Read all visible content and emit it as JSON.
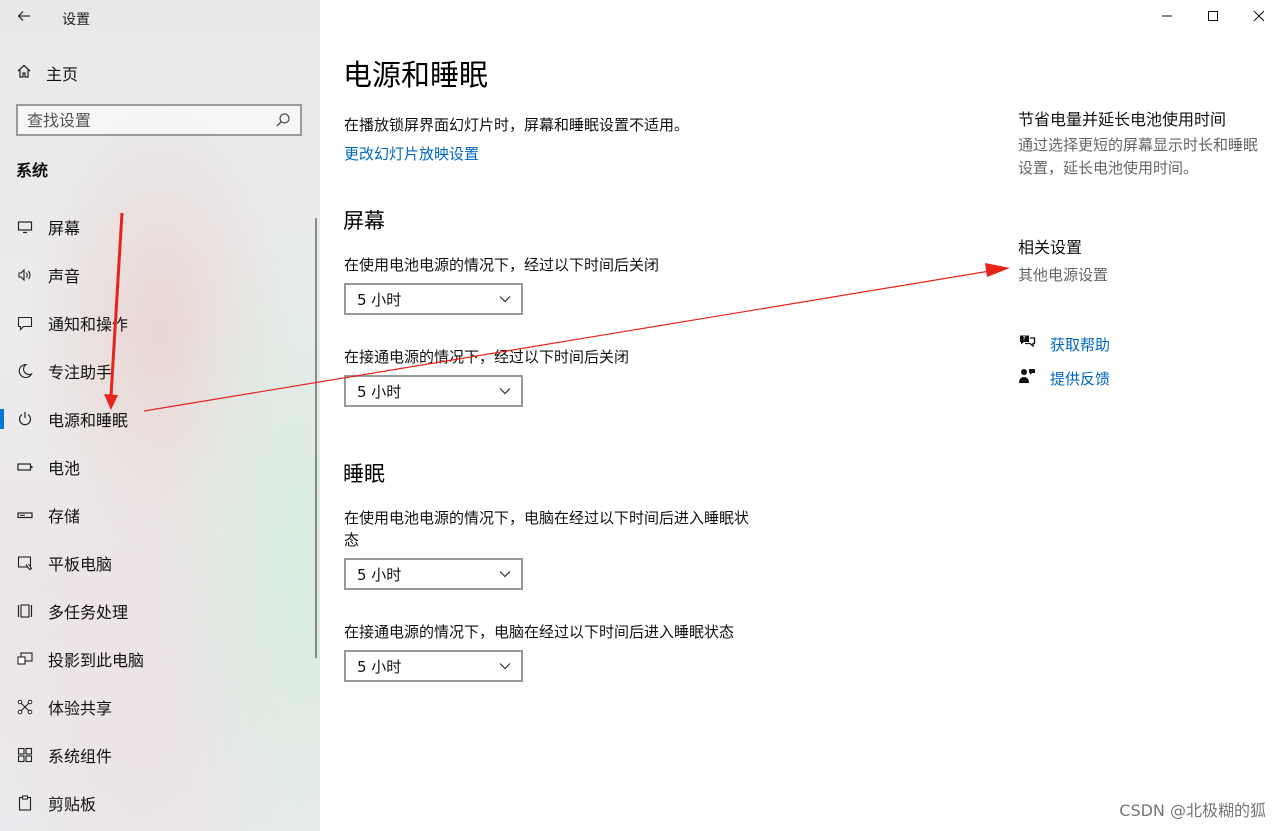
{
  "window": {
    "title": "设置",
    "minimize": "—",
    "maximize": "☐",
    "close": "✕"
  },
  "sidebar": {
    "home_label": "主页",
    "search_placeholder": "查找设置",
    "section_title": "系统",
    "items": [
      {
        "icon": "monitor-icon",
        "label": "屏幕"
      },
      {
        "icon": "speaker-icon",
        "label": "声音"
      },
      {
        "icon": "notification-icon",
        "label": "通知和操作"
      },
      {
        "icon": "moon-icon",
        "label": "专注助手"
      },
      {
        "icon": "power-icon",
        "label": "电源和睡眠",
        "active": true
      },
      {
        "icon": "battery-icon",
        "label": "电池"
      },
      {
        "icon": "storage-icon",
        "label": "存储"
      },
      {
        "icon": "tablet-icon",
        "label": "平板电脑"
      },
      {
        "icon": "multitask-icon",
        "label": "多任务处理"
      },
      {
        "icon": "project-icon",
        "label": "投影到此电脑"
      },
      {
        "icon": "shared-experience-icon",
        "label": "体验共享"
      },
      {
        "icon": "components-icon",
        "label": "系统组件"
      },
      {
        "icon": "clipboard-icon",
        "label": "剪贴板"
      }
    ]
  },
  "main": {
    "title": "电源和睡眠",
    "slideshow_note": "在播放锁屏界面幻灯片时，屏幕和睡眠设置不适用。",
    "slideshow_link": "更改幻灯片放映设置",
    "screen": {
      "heading": "屏幕",
      "battery_label": "在使用电池电源的情况下，经过以下时间后关闭",
      "battery_value": "5 小时",
      "plugged_label": "在接通电源的情况下，经过以下时间后关闭",
      "plugged_value": "5 小时"
    },
    "sleep": {
      "heading": "睡眠",
      "battery_label_1": "在使用电池电源的情况下，电脑在经过以下时间后进入睡眠状",
      "battery_label_2": "态",
      "battery_value": "5 小时",
      "plugged_label": "在接通电源的情况下，电脑在经过以下时间后进入睡眠状态",
      "plugged_value": "5 小时"
    }
  },
  "right": {
    "save_title": "节省电量并延长电池使用时间",
    "save_text": "通过选择更短的屏幕显示时长和睡眠设置，延长电池使用时间。",
    "related_title": "相关设置",
    "related_link": "其他电源设置",
    "help_label": "获取帮助",
    "feedback_label": "提供反馈"
  },
  "watermark": "CSDN @北极糊的狐",
  "colors": {
    "accent": "#0078d7",
    "link": "#0067c0",
    "annotation_arrow": "#e8231c"
  }
}
